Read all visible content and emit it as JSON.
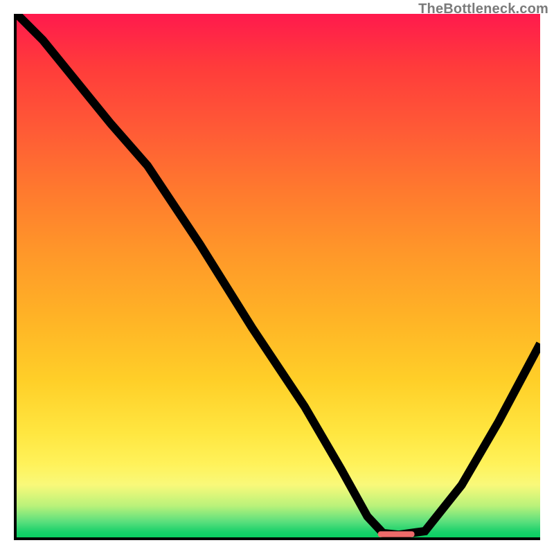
{
  "watermark": "TheBottleneck.com",
  "chart_data": {
    "type": "line",
    "title": "",
    "xlabel": "",
    "ylabel": "",
    "xlim": [
      0,
      100
    ],
    "ylim": [
      0,
      100
    ],
    "grid": false,
    "legend": false,
    "series": [
      {
        "name": "bottleneck-curve",
        "x": [
          0,
          5,
          18,
          25,
          35,
          45,
          55,
          62,
          67,
          70,
          73,
          78,
          85,
          92,
          100
        ],
        "values": [
          100,
          95,
          79,
          71,
          56,
          40,
          25,
          13,
          4,
          0.8,
          0.5,
          1.2,
          10,
          22,
          37
        ]
      }
    ],
    "marker": {
      "name": "optimum-marker",
      "x_start": 69,
      "x_end": 76,
      "y": 0.6,
      "color": "#ed6a6a"
    },
    "background": {
      "type": "gradient",
      "stops": [
        {
          "pos": 0,
          "color": "#ff1a4d"
        },
        {
          "pos": 50,
          "color": "#ff9829"
        },
        {
          "pos": 85,
          "color": "#fff25a"
        },
        {
          "pos": 100,
          "color": "#0acf62"
        }
      ]
    }
  }
}
